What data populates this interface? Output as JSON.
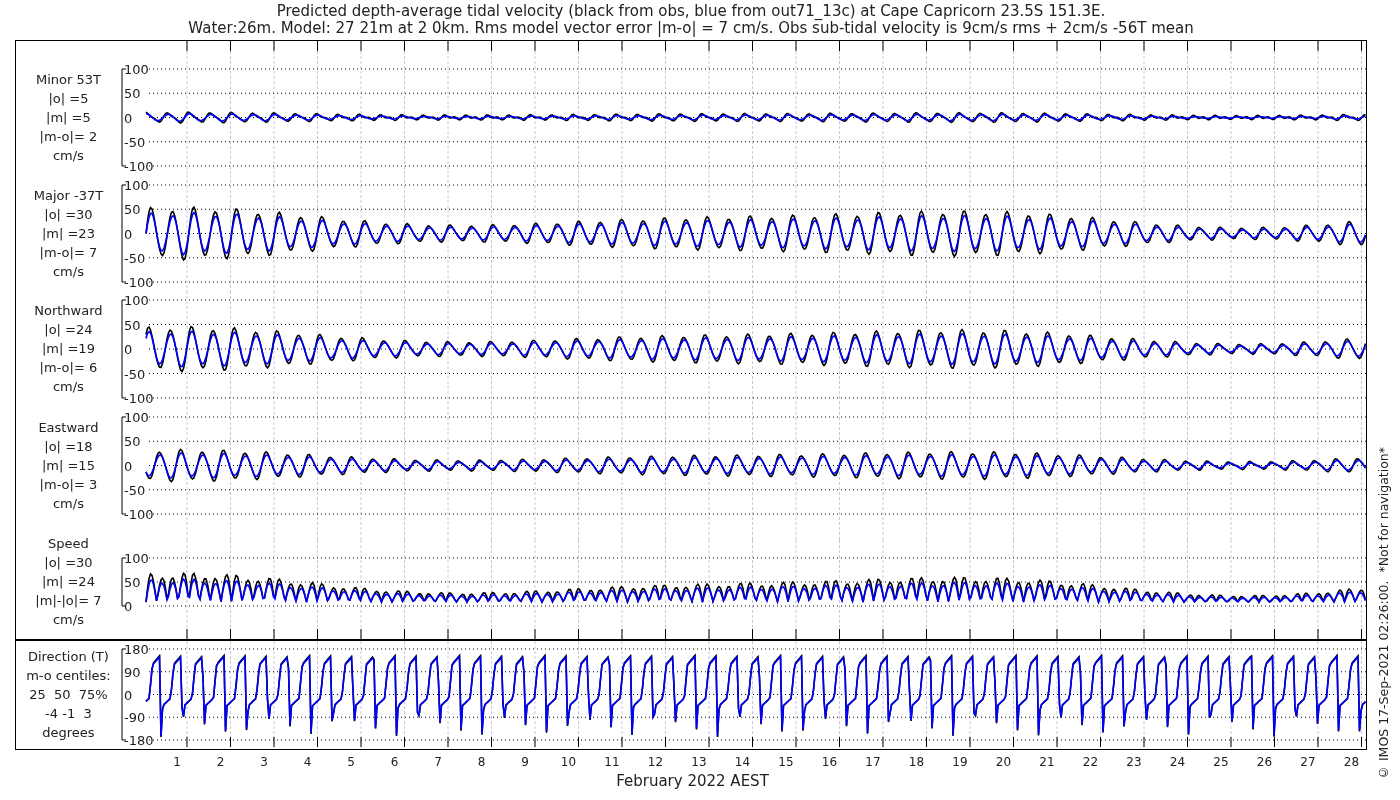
{
  "title": [
    "Predicted depth-average tidal velocity (black from obs, blue from out71_13c) at Cape Capricorn 23.5S 151.3E.",
    "Water:26m. Model: 27 21m at 2 0km. Rms model vector error |m-o| = 7 cm/s. Obs sub-tidal velocity is 9cm/s rms + 2cm/s -56T mean"
  ],
  "panels": [
    {
      "kind": "velocity",
      "label": [
        "Minor 53T",
        "|o| =5",
        "|m| =5",
        "|m-o|= 2",
        "cm/s"
      ],
      "yticks": [
        "100",
        "50",
        "0",
        "-50",
        "-100"
      ]
    },
    {
      "kind": "velocity",
      "label": [
        "Major -37T",
        "|o| =30",
        "|m| =23",
        "|m-o|= 7",
        "cm/s"
      ],
      "yticks": [
        "100",
        "50",
        "0",
        "-50",
        "-100"
      ]
    },
    {
      "kind": "velocity",
      "label": [
        "Northward",
        "|o| =24",
        "|m| =19",
        "|m-o|= 6",
        "cm/s"
      ],
      "yticks": [
        "100",
        "50",
        "0",
        "-50",
        "-100"
      ]
    },
    {
      "kind": "velocity",
      "label": [
        "Eastward",
        "|o| =18",
        "|m| =15",
        "|m-o|= 3",
        "cm/s"
      ],
      "yticks": [
        "100",
        "50",
        "0",
        "-50",
        "-100"
      ]
    },
    {
      "kind": "speed",
      "label": [
        "Speed",
        "|o| =30",
        "|m| =24",
        "|m|-|o|= 7",
        "cm/s"
      ],
      "yticks": [
        "100",
        "50",
        "0"
      ]
    },
    {
      "kind": "direction",
      "label": [
        "Direction (T)",
        "m-o centiles:",
        "25  50  75%",
        "-4 -1  3",
        "degrees"
      ],
      "yticks": [
        "180",
        "90",
        "0",
        "-90",
        "-180"
      ]
    }
  ],
  "x_axis": {
    "days": [
      "1",
      "2",
      "3",
      "4",
      "5",
      "6",
      "7",
      "8",
      "9",
      "10",
      "11",
      "12",
      "13",
      "14",
      "15",
      "16",
      "17",
      "18",
      "19",
      "20",
      "21",
      "22",
      "23",
      "24",
      "25",
      "26",
      "27",
      "28"
    ],
    "label": "February 2022 AEST"
  },
  "footer": "© IMOS 17-Sep-2021 02:26:00.  *Not for navigation*"
}
